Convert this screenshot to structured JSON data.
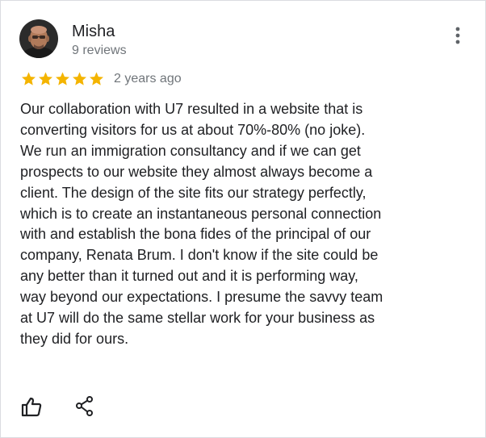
{
  "review": {
    "author_name": "Misha",
    "author_reviews": "9 reviews",
    "rating": 5,
    "rating_max": 5,
    "star_color": "#f4b400",
    "time_ago": "2 years ago",
    "text": "Our collaboration with U7 resulted in a website that is\nconverting visitors for us at about 70%-80% (no joke).\nWe run an immigration consultancy and if we can get\nprospects to our website they almost always become a\nclient. The design of the site fits our strategy perfectly,\nwhich is to create an instantaneous personal connection\nwith and establish the bona fides of the principal of our\ncompany, Renata Brum. I don't know if the site could be\nany better than it turned out and it is performing way,\nway beyond our expectations. I presume the savvy team\nat U7 will do the same stellar work for your business as\nthey did for ours."
  },
  "icons": {
    "more": "more-vertical-icon",
    "like": "thumbs-up-icon",
    "share": "share-icon",
    "star": "star-icon"
  }
}
